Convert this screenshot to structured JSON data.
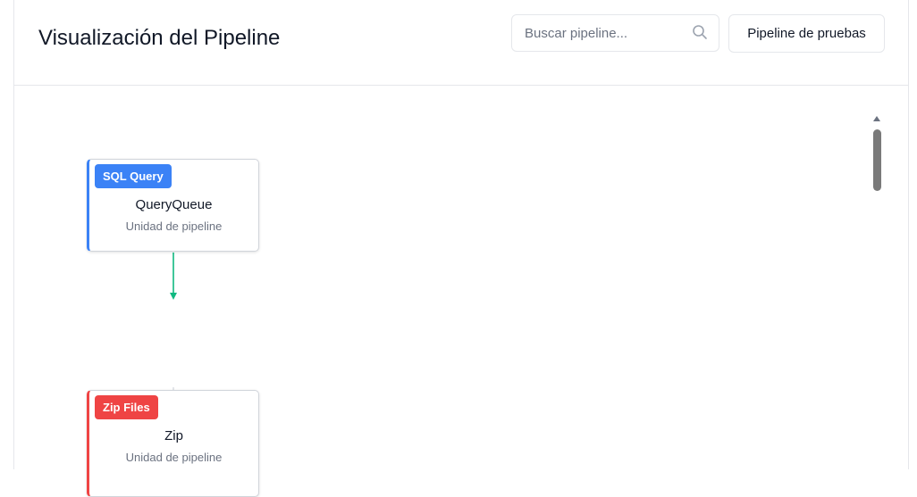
{
  "header": {
    "title": "Visualización del Pipeline",
    "search_placeholder": "Buscar pipeline...",
    "search_value": "",
    "test_button_label": "Pipeline de pruebas"
  },
  "nodes": [
    {
      "badge": "SQL Query",
      "name": "QueryQueue",
      "subtitle": "Unidad de pipeline",
      "color": "#3b82f6"
    },
    {
      "badge": "Zip Files",
      "name": "Zip",
      "subtitle": "Unidad de pipeline",
      "color": "#ef4444"
    }
  ],
  "colors": {
    "connector": "#10b981",
    "border": "#e5e7eb",
    "text_muted": "#6b7280"
  }
}
